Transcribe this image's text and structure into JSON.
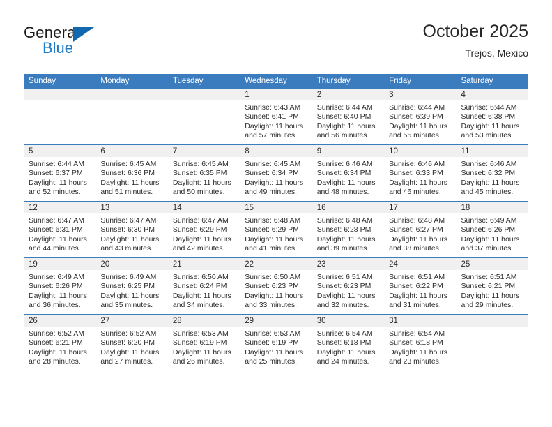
{
  "brand": {
    "name_dark": "General",
    "name_blue": "Blue",
    "triangle_color": "#1168ae",
    "blue_color": "#1f7ac4"
  },
  "header": {
    "title": "October 2025",
    "subtitle": "Trejos, Mexico"
  },
  "colors": {
    "header_row_bg": "#3b7cbf",
    "daynum_band_bg": "#f0f0f0",
    "row_divider": "#3b7cbf",
    "text": "#2b2b2b"
  },
  "weekdays": [
    "Sunday",
    "Monday",
    "Tuesday",
    "Wednesday",
    "Thursday",
    "Friday",
    "Saturday"
  ],
  "labels": {
    "sunrise_prefix": "Sunrise:",
    "sunset_prefix": "Sunset:",
    "daylight_prefix": "Daylight:"
  },
  "weeks": [
    [
      {
        "day": "",
        "empty": true
      },
      {
        "day": "",
        "empty": true
      },
      {
        "day": "",
        "empty": true
      },
      {
        "day": "1",
        "sunrise": "Sunrise: 6:43 AM",
        "sunset": "Sunset: 6:41 PM",
        "daylight_line1": "Daylight: 11 hours",
        "daylight_line2": "and 57 minutes."
      },
      {
        "day": "2",
        "sunrise": "Sunrise: 6:44 AM",
        "sunset": "Sunset: 6:40 PM",
        "daylight_line1": "Daylight: 11 hours",
        "daylight_line2": "and 56 minutes."
      },
      {
        "day": "3",
        "sunrise": "Sunrise: 6:44 AM",
        "sunset": "Sunset: 6:39 PM",
        "daylight_line1": "Daylight: 11 hours",
        "daylight_line2": "and 55 minutes."
      },
      {
        "day": "4",
        "sunrise": "Sunrise: 6:44 AM",
        "sunset": "Sunset: 6:38 PM",
        "daylight_line1": "Daylight: 11 hours",
        "daylight_line2": "and 53 minutes."
      }
    ],
    [
      {
        "day": "5",
        "sunrise": "Sunrise: 6:44 AM",
        "sunset": "Sunset: 6:37 PM",
        "daylight_line1": "Daylight: 11 hours",
        "daylight_line2": "and 52 minutes."
      },
      {
        "day": "6",
        "sunrise": "Sunrise: 6:45 AM",
        "sunset": "Sunset: 6:36 PM",
        "daylight_line1": "Daylight: 11 hours",
        "daylight_line2": "and 51 minutes."
      },
      {
        "day": "7",
        "sunrise": "Sunrise: 6:45 AM",
        "sunset": "Sunset: 6:35 PM",
        "daylight_line1": "Daylight: 11 hours",
        "daylight_line2": "and 50 minutes."
      },
      {
        "day": "8",
        "sunrise": "Sunrise: 6:45 AM",
        "sunset": "Sunset: 6:34 PM",
        "daylight_line1": "Daylight: 11 hours",
        "daylight_line2": "and 49 minutes."
      },
      {
        "day": "9",
        "sunrise": "Sunrise: 6:46 AM",
        "sunset": "Sunset: 6:34 PM",
        "daylight_line1": "Daylight: 11 hours",
        "daylight_line2": "and 48 minutes."
      },
      {
        "day": "10",
        "sunrise": "Sunrise: 6:46 AM",
        "sunset": "Sunset: 6:33 PM",
        "daylight_line1": "Daylight: 11 hours",
        "daylight_line2": "and 46 minutes."
      },
      {
        "day": "11",
        "sunrise": "Sunrise: 6:46 AM",
        "sunset": "Sunset: 6:32 PM",
        "daylight_line1": "Daylight: 11 hours",
        "daylight_line2": "and 45 minutes."
      }
    ],
    [
      {
        "day": "12",
        "sunrise": "Sunrise: 6:47 AM",
        "sunset": "Sunset: 6:31 PM",
        "daylight_line1": "Daylight: 11 hours",
        "daylight_line2": "and 44 minutes."
      },
      {
        "day": "13",
        "sunrise": "Sunrise: 6:47 AM",
        "sunset": "Sunset: 6:30 PM",
        "daylight_line1": "Daylight: 11 hours",
        "daylight_line2": "and 43 minutes."
      },
      {
        "day": "14",
        "sunrise": "Sunrise: 6:47 AM",
        "sunset": "Sunset: 6:29 PM",
        "daylight_line1": "Daylight: 11 hours",
        "daylight_line2": "and 42 minutes."
      },
      {
        "day": "15",
        "sunrise": "Sunrise: 6:48 AM",
        "sunset": "Sunset: 6:29 PM",
        "daylight_line1": "Daylight: 11 hours",
        "daylight_line2": "and 41 minutes."
      },
      {
        "day": "16",
        "sunrise": "Sunrise: 6:48 AM",
        "sunset": "Sunset: 6:28 PM",
        "daylight_line1": "Daylight: 11 hours",
        "daylight_line2": "and 39 minutes."
      },
      {
        "day": "17",
        "sunrise": "Sunrise: 6:48 AM",
        "sunset": "Sunset: 6:27 PM",
        "daylight_line1": "Daylight: 11 hours",
        "daylight_line2": "and 38 minutes."
      },
      {
        "day": "18",
        "sunrise": "Sunrise: 6:49 AM",
        "sunset": "Sunset: 6:26 PM",
        "daylight_line1": "Daylight: 11 hours",
        "daylight_line2": "and 37 minutes."
      }
    ],
    [
      {
        "day": "19",
        "sunrise": "Sunrise: 6:49 AM",
        "sunset": "Sunset: 6:26 PM",
        "daylight_line1": "Daylight: 11 hours",
        "daylight_line2": "and 36 minutes."
      },
      {
        "day": "20",
        "sunrise": "Sunrise: 6:49 AM",
        "sunset": "Sunset: 6:25 PM",
        "daylight_line1": "Daylight: 11 hours",
        "daylight_line2": "and 35 minutes."
      },
      {
        "day": "21",
        "sunrise": "Sunrise: 6:50 AM",
        "sunset": "Sunset: 6:24 PM",
        "daylight_line1": "Daylight: 11 hours",
        "daylight_line2": "and 34 minutes."
      },
      {
        "day": "22",
        "sunrise": "Sunrise: 6:50 AM",
        "sunset": "Sunset: 6:23 PM",
        "daylight_line1": "Daylight: 11 hours",
        "daylight_line2": "and 33 minutes."
      },
      {
        "day": "23",
        "sunrise": "Sunrise: 6:51 AM",
        "sunset": "Sunset: 6:23 PM",
        "daylight_line1": "Daylight: 11 hours",
        "daylight_line2": "and 32 minutes."
      },
      {
        "day": "24",
        "sunrise": "Sunrise: 6:51 AM",
        "sunset": "Sunset: 6:22 PM",
        "daylight_line1": "Daylight: 11 hours",
        "daylight_line2": "and 31 minutes."
      },
      {
        "day": "25",
        "sunrise": "Sunrise: 6:51 AM",
        "sunset": "Sunset: 6:21 PM",
        "daylight_line1": "Daylight: 11 hours",
        "daylight_line2": "and 29 minutes."
      }
    ],
    [
      {
        "day": "26",
        "sunrise": "Sunrise: 6:52 AM",
        "sunset": "Sunset: 6:21 PM",
        "daylight_line1": "Daylight: 11 hours",
        "daylight_line2": "and 28 minutes."
      },
      {
        "day": "27",
        "sunrise": "Sunrise: 6:52 AM",
        "sunset": "Sunset: 6:20 PM",
        "daylight_line1": "Daylight: 11 hours",
        "daylight_line2": "and 27 minutes."
      },
      {
        "day": "28",
        "sunrise": "Sunrise: 6:53 AM",
        "sunset": "Sunset: 6:19 PM",
        "daylight_line1": "Daylight: 11 hours",
        "daylight_line2": "and 26 minutes."
      },
      {
        "day": "29",
        "sunrise": "Sunrise: 6:53 AM",
        "sunset": "Sunset: 6:19 PM",
        "daylight_line1": "Daylight: 11 hours",
        "daylight_line2": "and 25 minutes."
      },
      {
        "day": "30",
        "sunrise": "Sunrise: 6:54 AM",
        "sunset": "Sunset: 6:18 PM",
        "daylight_line1": "Daylight: 11 hours",
        "daylight_line2": "and 24 minutes."
      },
      {
        "day": "31",
        "sunrise": "Sunrise: 6:54 AM",
        "sunset": "Sunset: 6:18 PM",
        "daylight_line1": "Daylight: 11 hours",
        "daylight_line2": "and 23 minutes."
      },
      {
        "day": "",
        "empty": true
      }
    ]
  ]
}
